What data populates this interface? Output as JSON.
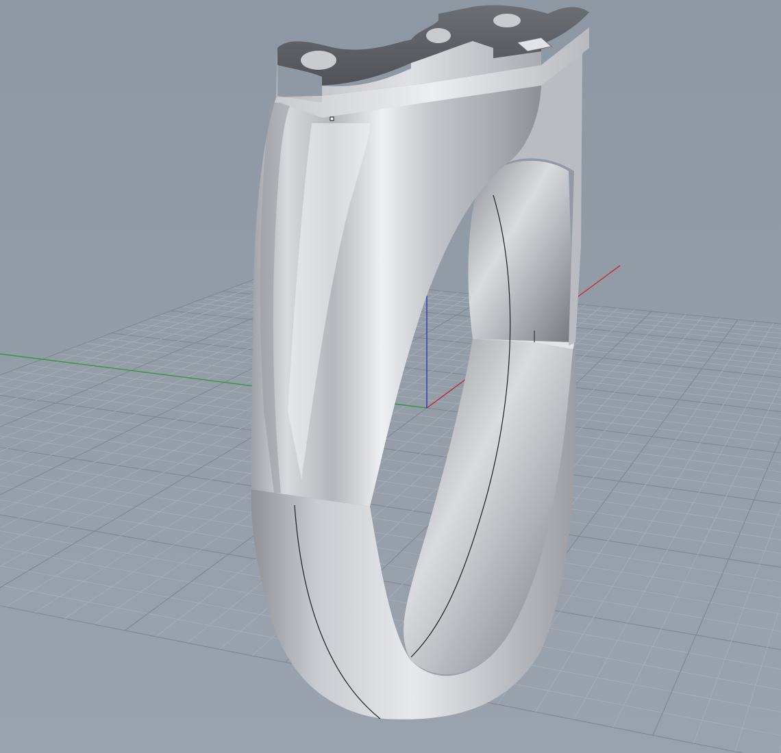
{
  "viewport": {
    "projection": "perspective",
    "display_mode": "shaded",
    "grid_visible": true,
    "world_axes_visible": true
  },
  "colors": {
    "background": "#939da8",
    "grid_minor": "#a7afb8",
    "grid_major": "#7f8892",
    "axis_x": "#c8292a",
    "axis_y": "#2e9a3a",
    "axis_z": "#2a35c8",
    "metal_light": "#f4f5f7",
    "metal_mid": "#c6c8cc",
    "metal_dark": "#7c7f84",
    "text_relief": "#5a5d62"
  },
  "model": {
    "object": "signet-name-ring",
    "material": "silver"
  }
}
